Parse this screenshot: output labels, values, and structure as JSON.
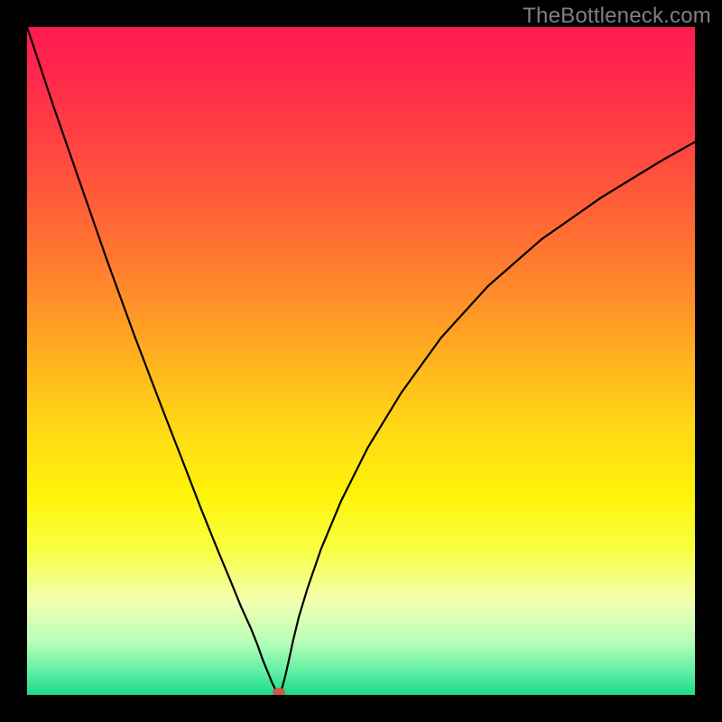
{
  "watermark": "TheBottleneck.com",
  "chart_data": {
    "type": "line",
    "title": "",
    "xlabel": "",
    "ylabel": "",
    "xlim": [
      0,
      1
    ],
    "ylim": [
      0,
      1
    ],
    "grid": false,
    "legend": false,
    "background_gradient_stops": [
      {
        "pos": 0.0,
        "color": "#ff1a50"
      },
      {
        "pos": 0.1,
        "color": "#ff2f49"
      },
      {
        "pos": 0.2,
        "color": "#ff4a3f"
      },
      {
        "pos": 0.3,
        "color": "#ff6a34"
      },
      {
        "pos": 0.4,
        "color": "#ff8c2a"
      },
      {
        "pos": 0.5,
        "color": "#ffb31f"
      },
      {
        "pos": 0.6,
        "color": "#ffd815"
      },
      {
        "pos": 0.7,
        "color": "#fff30a"
      },
      {
        "pos": 0.78,
        "color": "#f8ff40"
      },
      {
        "pos": 0.86,
        "color": "#f2ffb0"
      },
      {
        "pos": 0.92,
        "color": "#b8ffb8"
      },
      {
        "pos": 0.97,
        "color": "#55eda0"
      },
      {
        "pos": 1.0,
        "color": "#1fd98a"
      }
    ],
    "curve": {
      "description": "V-shaped bottleneck curve; y is fraction from top (0) to bottom (1); x is fraction from left (0) to right (1)",
      "x": [
        0.0,
        0.04,
        0.08,
        0.12,
        0.16,
        0.2,
        0.235,
        0.26,
        0.285,
        0.305,
        0.32,
        0.335,
        0.345,
        0.352,
        0.358,
        0.363,
        0.367,
        0.371,
        0.374,
        0.377,
        0.38,
        0.383,
        0.387,
        0.392,
        0.398,
        0.407,
        0.42,
        0.44,
        0.47,
        0.51,
        0.56,
        0.62,
        0.69,
        0.77,
        0.86,
        0.95,
        1.0
      ],
      "y": [
        0.0,
        0.12,
        0.235,
        0.35,
        0.46,
        0.565,
        0.655,
        0.72,
        0.782,
        0.83,
        0.867,
        0.9,
        0.925,
        0.945,
        0.96,
        0.972,
        0.982,
        0.99,
        0.996,
        1.0,
        0.995,
        0.985,
        0.97,
        0.948,
        0.92,
        0.883,
        0.84,
        0.782,
        0.71,
        0.63,
        0.548,
        0.465,
        0.388,
        0.318,
        0.255,
        0.2,
        0.172
      ]
    },
    "marker": {
      "x": 0.377,
      "y": 1.0,
      "color": "#cc5a4a"
    }
  }
}
